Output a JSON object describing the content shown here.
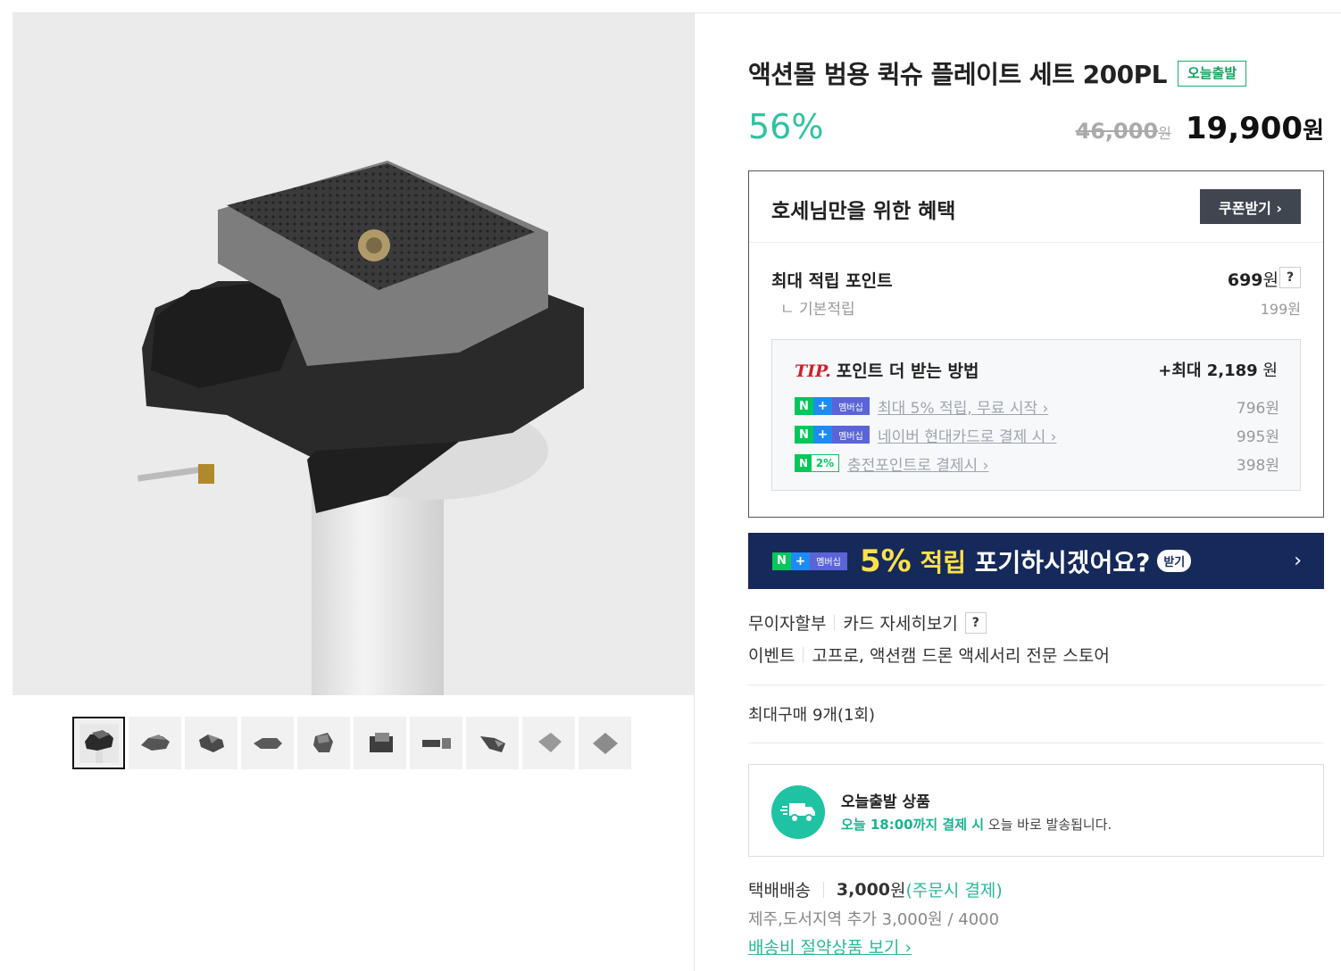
{
  "product": {
    "title": "액션몰 범용 퀵슈 플레이트 세트 200PL",
    "today_badge": "오늘출발",
    "discount": "56%",
    "original_price": "46,000",
    "original_won": "원",
    "sale_price": "19,900",
    "sale_won": "원"
  },
  "gallery": {
    "thumbnail_count": 10,
    "active_index": 0
  },
  "benefit": {
    "title": "호세님만을 위한 혜택",
    "coupon_button": "쿠폰받기 ›",
    "max_points_label": "최대 적립 포인트",
    "max_points_value": "699",
    "won": "원",
    "help": "?",
    "base_label": "ㄴ  기본적립",
    "base_value": "199원",
    "tip": {
      "mark": "TIP.",
      "title": "포인트 더 받는 방법",
      "max_prefix": "+최대 ",
      "max_value": "2,189",
      "max_won": " 원",
      "rows": [
        {
          "link": "최대 5% 적립, 무료 시작 ›",
          "amount": "796원"
        },
        {
          "link": "네이버 현대카드로 결제 시 ›",
          "amount": "995원"
        },
        {
          "link": "충전포인트로 결제시 ›",
          "amount": "398원"
        }
      ],
      "badge_n": "N",
      "badge_plus": "+",
      "badge_membership": "멤버십",
      "badge_pay_n": "N",
      "badge_pay_pct": "2%"
    }
  },
  "banner": {
    "pct": "5%",
    "accrue": " 적립",
    "rest": " 포기하시겠어요?",
    "get": "받기",
    "arrow": "›"
  },
  "installment": {
    "label": "무이자할부",
    "card_link": "카드 자세히보기",
    "help": "?"
  },
  "event": {
    "label": "이벤트",
    "text": "고프로, 액션캠 드론 액세서리 전문 스토어"
  },
  "max_purchase": "최대구매 9개(1회)",
  "shipping_today": {
    "title": "오늘출발 상품",
    "highlight": "오늘 18:00까지 결제 시",
    "rest": " 오늘 바로 발송됩니다."
  },
  "delivery": {
    "method": "택배배송",
    "fee": "3,000",
    "fee_won": "원",
    "note": "(주문시 결제)",
    "jeju": "제주,도서지역 추가 3,000원 / 4000",
    "save_link": "배송비 절약상품 보기 ›"
  },
  "colors": {
    "accent_teal": "#2fc2a3",
    "naver_green": "#03c75a",
    "banner_navy": "#15295a",
    "banner_yellow": "#ffe14b",
    "tip_red": "#d21e2b"
  }
}
